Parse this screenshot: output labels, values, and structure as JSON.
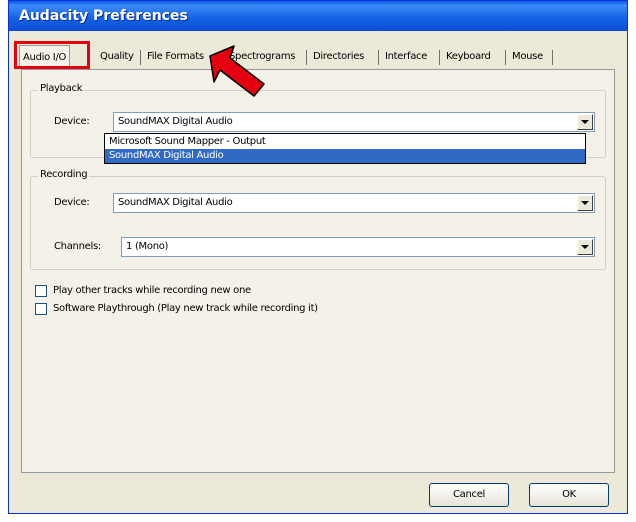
{
  "window": {
    "title": "Audacity Preferences"
  },
  "tabs": [
    {
      "label": "Audio I/O",
      "active": true
    },
    {
      "label": "Quality"
    },
    {
      "label": "File Formats"
    },
    {
      "label": "Spectrograms"
    },
    {
      "label": "Directories"
    },
    {
      "label": "Interface"
    },
    {
      "label": "Keyboard"
    },
    {
      "label": "Mouse"
    }
  ],
  "playback": {
    "title": "Playback",
    "device_label": "Device:",
    "device_value": "SoundMAX Digital Audio",
    "dropdown_options": [
      "Microsoft Sound Mapper - Output",
      "SoundMAX Digital Audio"
    ],
    "dropdown_selected": "SoundMAX Digital Audio"
  },
  "recording": {
    "title": "Recording",
    "device_label": "Device:",
    "device_value": "SoundMAX Digital Audio",
    "channels_label": "Channels:",
    "channels_value": "1 (Mono)"
  },
  "options": {
    "play_other_tracks": {
      "label": "Play other tracks while recording new one",
      "checked": false
    },
    "software_playthrough": {
      "label": "Software Playthrough (Play new track while recording it)",
      "checked": false
    }
  },
  "buttons": {
    "cancel": "Cancel",
    "ok": "OK"
  },
  "colors": {
    "annotation_red": "#e3000f",
    "titlebar_blue": "#0b4cd0",
    "selection_blue": "#316ac5"
  }
}
